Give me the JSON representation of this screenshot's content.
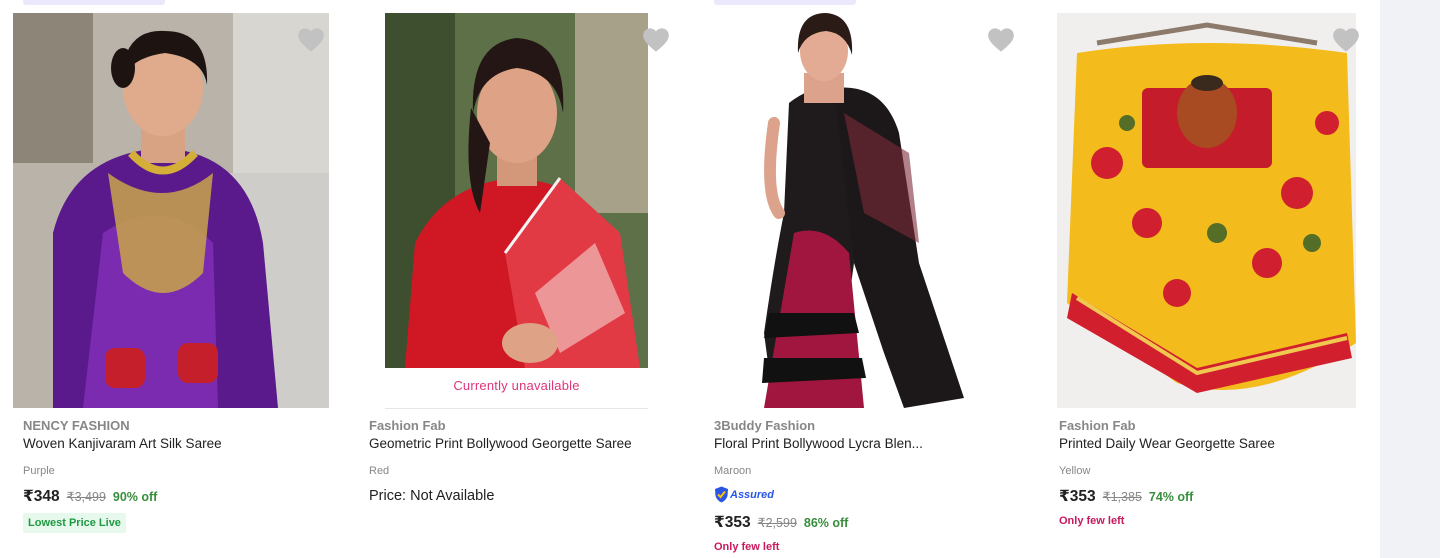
{
  "colors": {
    "accent_unavailable": "#e0357a",
    "discount": "#388e3c",
    "few_left": "#c8195d",
    "lowest_bg": "#e7f8ec",
    "lowest_text": "#1f9a43"
  },
  "products": [
    {
      "brand": "NENCY FASHION",
      "title": "Woven Kanjivaram Art Silk Saree",
      "color": "Purple",
      "price": "₹348",
      "mrp": "₹3,499",
      "discount": "90% off",
      "badge": "Lowest Price Live",
      "wishlist_icon": "heart-icon"
    },
    {
      "brand": "Fashion Fab",
      "title": "Geometric Print Bollywood Georgette Saree",
      "color": "Red",
      "unavailable": "Currently unavailable",
      "price_text": "Price: Not Available",
      "wishlist_icon": "heart-icon"
    },
    {
      "brand": "3Buddy Fashion",
      "title": "Floral Print Bollywood Lycra Blen...",
      "color": "Maroon",
      "assured": "Assured",
      "price": "₹353",
      "mrp": "₹2,599",
      "discount": "86% off",
      "stock": "Only few left",
      "wishlist_icon": "heart-icon"
    },
    {
      "brand": "Fashion Fab",
      "title": "Printed Daily Wear Georgette Saree",
      "color": "Yellow",
      "price": "₹353",
      "mrp": "₹1,385",
      "discount": "74% off",
      "stock": "Only few left",
      "wishlist_icon": "heart-icon"
    }
  ]
}
